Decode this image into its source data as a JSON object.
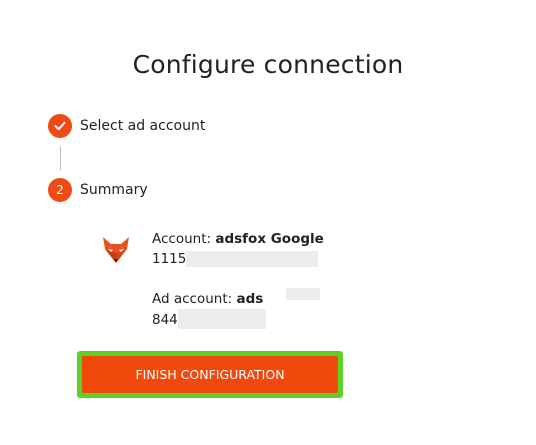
{
  "page": {
    "title": "Configure connection"
  },
  "steps": [
    {
      "marker": "✓",
      "label": "Select ad account",
      "status": "complete"
    },
    {
      "marker": "2",
      "label": "Summary",
      "status": "current"
    }
  ],
  "summary": {
    "account_label": "Account:",
    "account_name": "adsfox Google",
    "account_id_prefix": "11158",
    "ad_account_label": "Ad account:",
    "ad_account_name_prefix": "ads",
    "ad_account_id_prefix": "844"
  },
  "actions": {
    "finish_label": "FINISH CONFIGURATION"
  },
  "colors": {
    "accent": "#ef4a0b",
    "highlight": "#5fd125"
  }
}
